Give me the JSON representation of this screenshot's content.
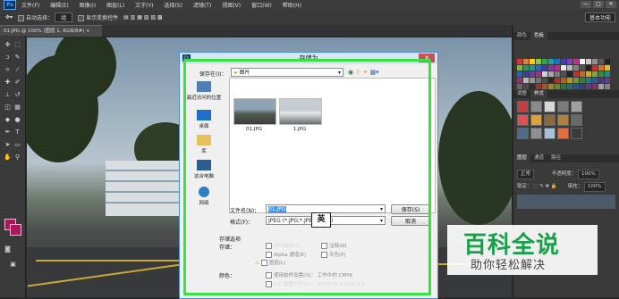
{
  "app": {
    "logo": "Ps"
  },
  "menu": [
    "文件(F)",
    "编辑(E)",
    "图像(I)",
    "图层(L)",
    "文字(Y)",
    "选择(S)",
    "滤镜(T)",
    "视图(V)",
    "窗口(W)",
    "帮助(H)"
  ],
  "window_controls": [
    "—",
    "□",
    "✕"
  ],
  "options": {
    "auto_select": "自动选择：",
    "auto_select_value": "组",
    "show_transform": "显示变换控件",
    "workspace": "基本功能"
  },
  "document": {
    "tab": "01.JPG @ 100% (图层 1, RGB/8#) ×"
  },
  "panels": {
    "top_tabs": [
      "颜色",
      "色板"
    ],
    "mid_tabs": [
      "调整",
      "样式"
    ],
    "layer_tabs": [
      "图层",
      "通道",
      "路径"
    ],
    "blend_mode": "正常",
    "opacity_label": "不透明度：",
    "opacity_value": "100%",
    "lock_label": "锁定：",
    "fill_label": "填充：",
    "fill_value": "100%"
  },
  "dialog": {
    "title": "存储为",
    "close": "✕",
    "save_in_label": "保存在(I)：",
    "save_in_value": "图片",
    "places": [
      "最近访问的位置",
      "桌面",
      "库",
      "这台电脑",
      "网络"
    ],
    "files": [
      {
        "name": "01.JPG"
      },
      {
        "name": "1.JPG"
      }
    ],
    "filename_label": "文件名(N)：",
    "filename_value": "01.JPG",
    "format_label": "格式(F)：",
    "format_value": "JPEG (*.JPG;*.JPEG;*.JPE)",
    "save_button": "保存(S)",
    "cancel_button": "取消",
    "save_options_title": "存储选项",
    "save_label": "存储：",
    "options": [
      "作为副本(Y)",
      "注释(N)",
      "Alpha 通道(E)",
      "专色(P)",
      "图层(L)"
    ],
    "color_label": "颜色：",
    "color_options": [
      "使用校样设置(O)：  工作中的 CMYK",
      "ICC 配置文件(C)：  sRGB IEC61966-2.1"
    ]
  },
  "ime": "英",
  "watermark": {
    "title": "百科全说",
    "subtitle": "助你轻松解决"
  }
}
